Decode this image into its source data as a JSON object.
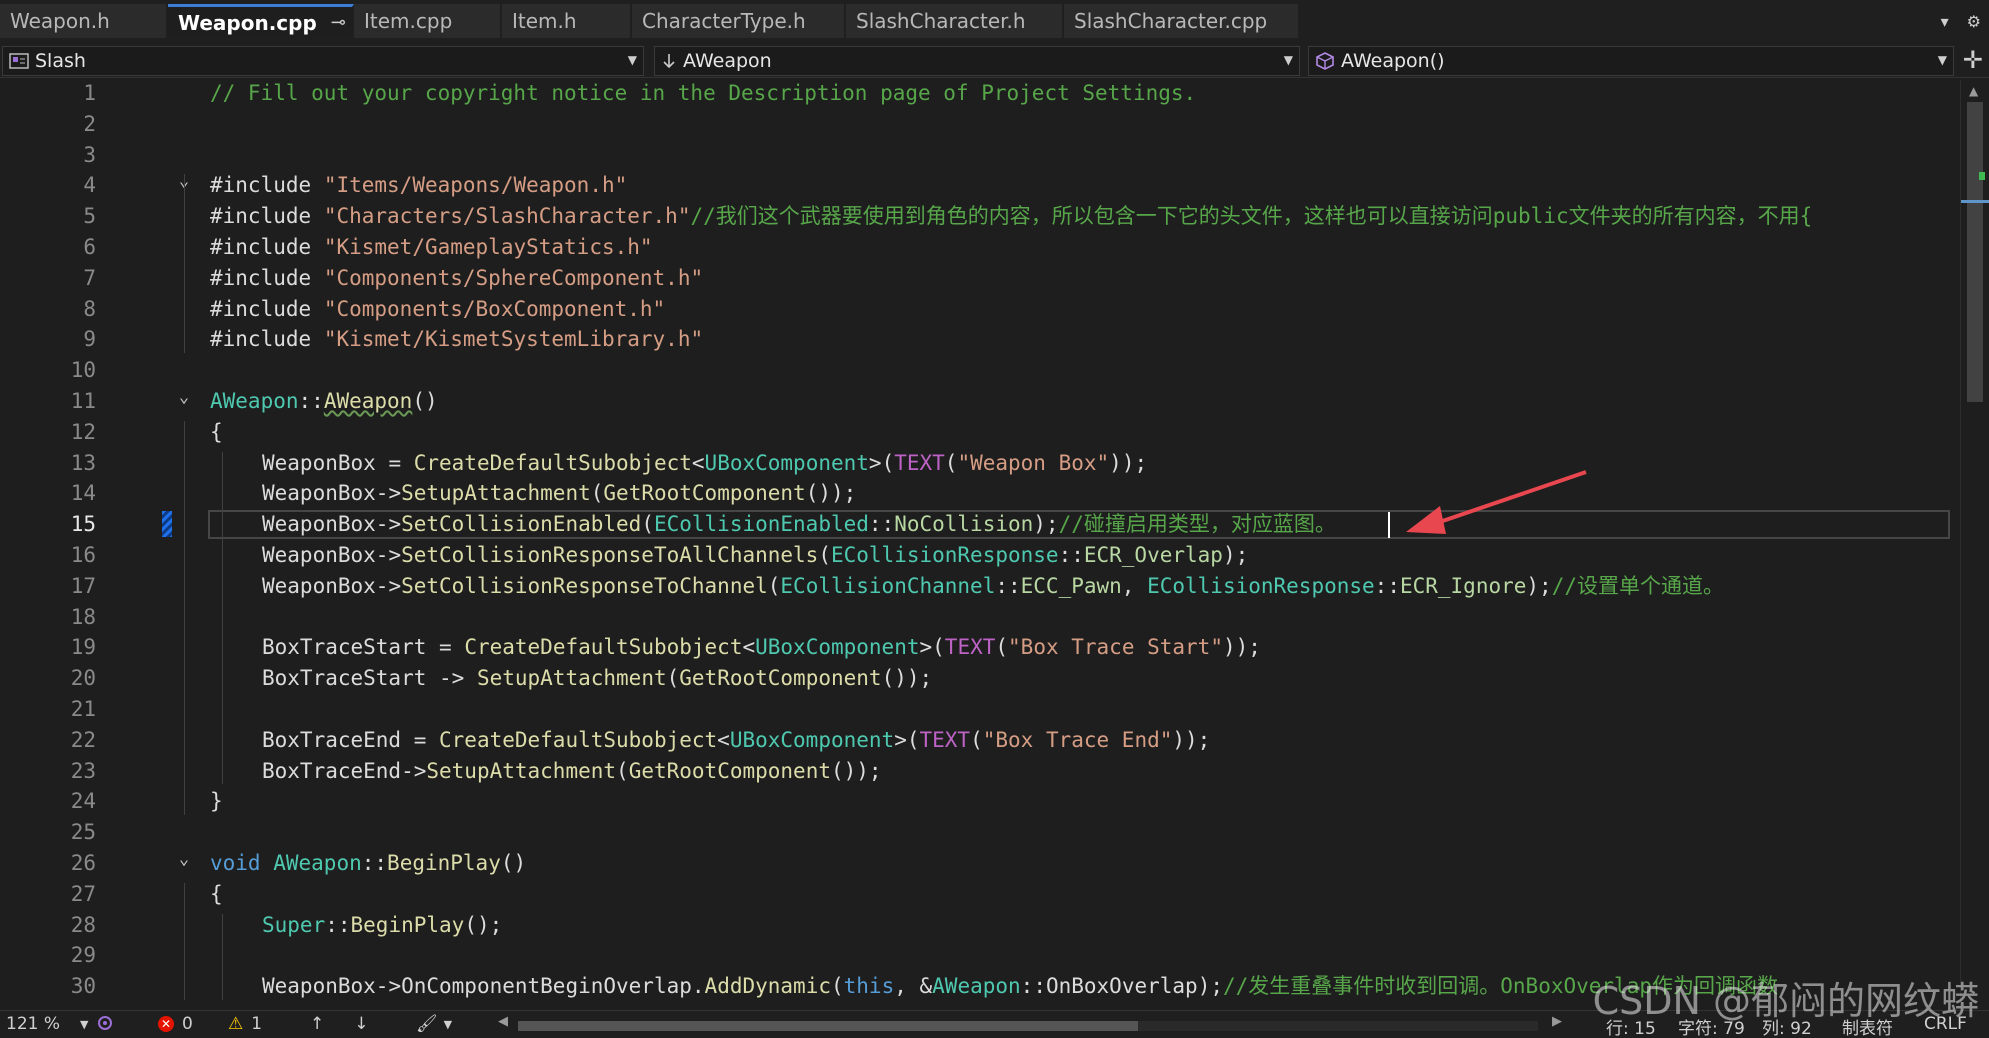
{
  "tabs": [
    {
      "label": "Weapon.h",
      "active": false
    },
    {
      "label": "Weapon.cpp",
      "active": true
    },
    {
      "label": "Item.cpp",
      "active": false
    },
    {
      "label": "Item.h",
      "active": false
    },
    {
      "label": "CharacterType.h",
      "active": false
    },
    {
      "label": "SlashCharacter.h",
      "active": false
    },
    {
      "label": "SlashCharacter.cpp",
      "active": false
    }
  ],
  "nav": {
    "project": "Slash",
    "scope": "AWeapon",
    "member": "AWeapon()"
  },
  "code_lines": [
    {
      "n": "1",
      "text": "// Fill out your copyright notice in the Description page of Project Settings."
    },
    {
      "n": "2",
      "text": ""
    },
    {
      "n": "3",
      "text": ""
    },
    {
      "n": "4",
      "text": "#include \"Items/Weapons/Weapon.h\""
    },
    {
      "n": "5",
      "text": "#include \"Characters/SlashCharacter.h\"//我们这个武器要使用到角色的内容，所以包含一下它的头文件，这样也可以直接访问public文件夹的所有内容，不用{"
    },
    {
      "n": "6",
      "text": "#include \"Kismet/GameplayStatics.h\""
    },
    {
      "n": "7",
      "text": "#include \"Components/SphereComponent.h\""
    },
    {
      "n": "8",
      "text": "#include \"Components/BoxComponent.h\""
    },
    {
      "n": "9",
      "text": "#include \"Kismet/KismetSystemLibrary.h\""
    },
    {
      "n": "10",
      "text": ""
    },
    {
      "n": "11",
      "text": "AWeapon::AWeapon()"
    },
    {
      "n": "12",
      "text": "{"
    },
    {
      "n": "13",
      "text": "WeaponBox = CreateDefaultSubobject<UBoxComponent>(TEXT(\"Weapon Box\"));"
    },
    {
      "n": "14",
      "text": "WeaponBox->SetupAttachment(GetRootComponent());"
    },
    {
      "n": "15",
      "text": "WeaponBox->SetCollisionEnabled(ECollisionEnabled::NoCollision);//碰撞启用类型，对应蓝图。"
    },
    {
      "n": "16",
      "text": "WeaponBox->SetCollisionResponseToAllChannels(ECollisionResponse::ECR_Overlap);"
    },
    {
      "n": "17",
      "text": "WeaponBox->SetCollisionResponseToChannel(ECollisionChannel::ECC_Pawn, ECollisionResponse::ECR_Ignore);//设置单个通道。"
    },
    {
      "n": "18",
      "text": ""
    },
    {
      "n": "19",
      "text": "BoxTraceStart = CreateDefaultSubobject<UBoxComponent>(TEXT(\"Box Trace Start\"));"
    },
    {
      "n": "20",
      "text": "BoxTraceStart -> SetupAttachment(GetRootComponent());"
    },
    {
      "n": "21",
      "text": ""
    },
    {
      "n": "22",
      "text": "BoxTraceEnd = CreateDefaultSubobject<UBoxComponent>(TEXT(\"Box Trace End\"));"
    },
    {
      "n": "23",
      "text": "BoxTraceEnd->SetupAttachment(GetRootComponent());"
    },
    {
      "n": "24",
      "text": "}"
    },
    {
      "n": "25",
      "text": ""
    },
    {
      "n": "26",
      "text": "void AWeapon::BeginPlay()"
    },
    {
      "n": "27",
      "text": "{"
    },
    {
      "n": "28",
      "text": "Super::BeginPlay();"
    },
    {
      "n": "29",
      "text": ""
    },
    {
      "n": "30",
      "text": "WeaponBox->OnComponentBeginOverlap.AddDynamic(this, &AWeapon::OnBoxOverlap);//发生重叠事件时收到回调。OnBoxOverlap作为回调函数"
    }
  ],
  "current_line": "15",
  "status": {
    "zoom": "121 %",
    "errors": "0",
    "warnings": "1",
    "line": "行: 15",
    "char": "字符: 79",
    "col": "列: 92",
    "indent": "制表符",
    "eol": "CRLF"
  },
  "watermark": "CSDN @郁闷的网纹蟒",
  "icons": {
    "pin": "pin-icon",
    "close": "close-icon",
    "dropdown": "chevron-down-icon",
    "settings": "gear-icon"
  },
  "colors": {
    "comment": "#57a64a",
    "keyword": "#569cd6",
    "string": "#d69d85",
    "class": "#4ec9b0",
    "function": "#dcdcaa",
    "macro": "#bd63c5",
    "annotation_arrow": "#e8474f"
  }
}
